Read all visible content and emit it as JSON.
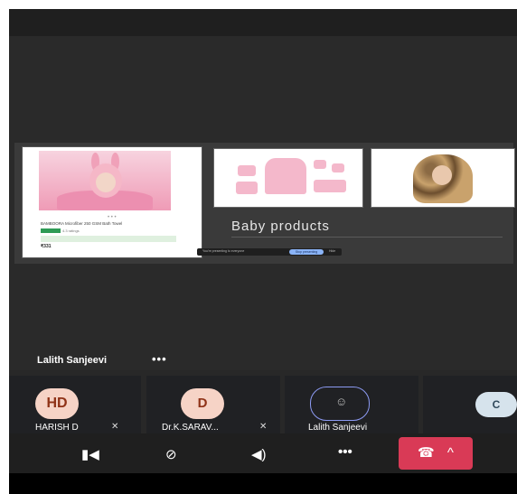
{
  "presentation": {
    "caption": "Baby products",
    "banner_text": "You're presenting to everyone",
    "banner_button": "Stop presenting",
    "banner_hide": "Hide",
    "product_title": "BAMBOORA Microfiber 250 GSM Bath Towel",
    "product_rating": "4.3 ratings",
    "product_price": "₹331"
  },
  "presenter": {
    "name": "Lalith Sanjeevi",
    "more_label": "•••"
  },
  "participants": [
    {
      "initials": "HD",
      "name": "HARISH D",
      "muted": true
    },
    {
      "initials": "D",
      "name": "Dr.K.SARAV...",
      "muted": true
    },
    {
      "initials": "",
      "name": "Lalith Sanjeevi",
      "muted": false
    },
    {
      "initials": "C",
      "name": "",
      "muted": false
    }
  ],
  "controls": {
    "camera_icon": "camera-off-icon",
    "mic_icon": "mic-off-icon",
    "speaker_icon": "speaker-icon",
    "more_label": "•••",
    "end_call_icon": "phone-hangup-icon",
    "chevron": "^"
  },
  "colors": {
    "end_call": "#d93a56",
    "avatar_bg": "#f6d3c6",
    "avatar_text": "#8f3217",
    "ring": "#8c9af2",
    "banner_button": "#8ab4f8"
  }
}
